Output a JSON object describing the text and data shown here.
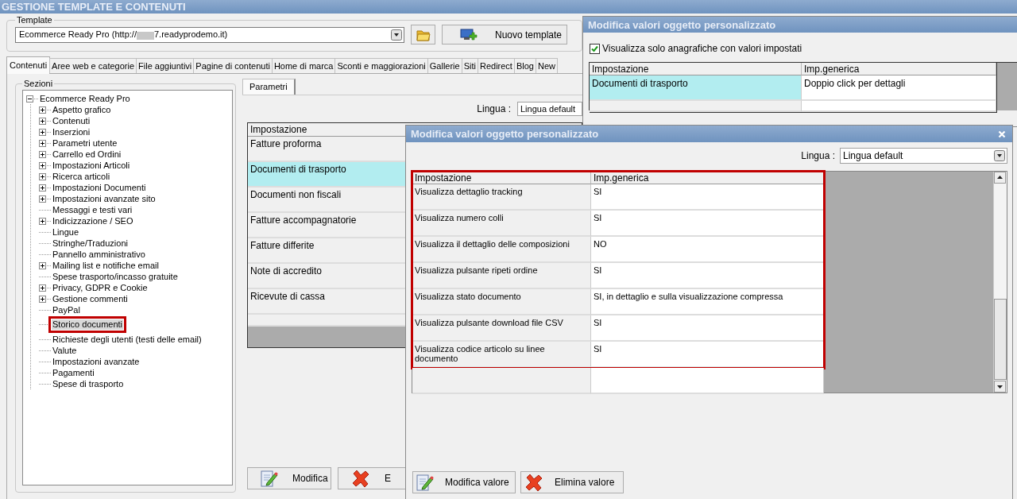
{
  "window": {
    "title": "GESTIONE TEMPLATE E CONTENUTI"
  },
  "template": {
    "label": "Template",
    "value_prefix": "Ecommerce Ready Pro (http://",
    "redacted": true,
    "value_suffix": "7.readyprodemo.it)",
    "new_button": "Nuovo template"
  },
  "tabs": [
    {
      "label": "Contenuti",
      "selected": true
    },
    {
      "label": "Aree web e categorie",
      "selected": false
    },
    {
      "label": "File aggiuntivi",
      "selected": false
    },
    {
      "label": "Pagine di contenuti",
      "selected": false
    },
    {
      "label": "Home di marca",
      "selected": false
    },
    {
      "label": "Sconti e maggiorazioni",
      "selected": false
    },
    {
      "label": "Gallerie",
      "selected": false
    },
    {
      "label": "Siti",
      "selected": false
    },
    {
      "label": "Redirect",
      "selected": false
    },
    {
      "label": "Blog",
      "selected": false
    },
    {
      "label": "New",
      "selected": false
    }
  ],
  "sections": {
    "title": "Sezioni",
    "tree": [
      {
        "label": "Ecommerce Ready Pro",
        "expanded": true,
        "children": [
          {
            "label": "Aspetto grafico",
            "expandable": true,
            "selected": false,
            "highlighted": false
          },
          {
            "label": "Contenuti",
            "expandable": true,
            "selected": false,
            "highlighted": false
          },
          {
            "label": "Inserzioni",
            "expandable": true,
            "selected": false,
            "highlighted": false
          },
          {
            "label": "Parametri utente",
            "expandable": true,
            "selected": false,
            "highlighted": false
          },
          {
            "label": "Carrello ed Ordini",
            "expandable": true,
            "selected": false,
            "highlighted": false
          },
          {
            "label": "Impostazioni Articoli",
            "expandable": true,
            "selected": false,
            "highlighted": false
          },
          {
            "label": "Ricerca articoli",
            "expandable": true,
            "selected": false,
            "highlighted": false
          },
          {
            "label": "Impostazioni Documenti",
            "expandable": true,
            "selected": false,
            "highlighted": false
          },
          {
            "label": "Impostazioni avanzate sito",
            "expandable": true,
            "selected": false,
            "highlighted": false
          },
          {
            "label": "Messaggi e testi vari",
            "expandable": false,
            "selected": false,
            "highlighted": false
          },
          {
            "label": "Indicizzazione / SEO",
            "expandable": true,
            "selected": false,
            "highlighted": false
          },
          {
            "label": "Lingue",
            "expandable": false,
            "selected": false,
            "highlighted": false
          },
          {
            "label": "Stringhe/Traduzioni",
            "expandable": false,
            "selected": false,
            "highlighted": false
          },
          {
            "label": "Pannello amministrativo",
            "expandable": false,
            "selected": false,
            "highlighted": false
          },
          {
            "label": "Mailing list e notifiche email",
            "expandable": true,
            "selected": false,
            "highlighted": false
          },
          {
            "label": "Spese trasporto/incasso gratuite",
            "expandable": false,
            "selected": false,
            "highlighted": false
          },
          {
            "label": "Privacy, GDPR e Cookie",
            "expandable": true,
            "selected": false,
            "highlighted": false
          },
          {
            "label": "Gestione commenti",
            "expandable": true,
            "selected": false,
            "highlighted": false
          },
          {
            "label": "PayPal",
            "expandable": false,
            "selected": false,
            "highlighted": false
          },
          {
            "label": "Storico documenti",
            "expandable": false,
            "selected": true,
            "highlighted": true
          },
          {
            "label": "Richieste degli utenti (testi delle email)",
            "expandable": false,
            "selected": false,
            "highlighted": false
          },
          {
            "label": "Valute",
            "expandable": false,
            "selected": false,
            "highlighted": false
          },
          {
            "label": "Impostazioni avanzate",
            "expandable": false,
            "selected": false,
            "highlighted": false
          },
          {
            "label": "Pagamenti",
            "expandable": false,
            "selected": false,
            "highlighted": false
          },
          {
            "label": "Spese di trasporto",
            "expandable": false,
            "selected": false,
            "highlighted": false
          }
        ]
      }
    ]
  },
  "params": {
    "tabs": [
      {
        "label": "Parametri",
        "selected": true
      }
    ],
    "language_label": "Lingua :",
    "language_value": "Lingua default",
    "columns": [
      "Impostazione"
    ],
    "rows": [
      {
        "label": "Fatture proforma",
        "selected": false
      },
      {
        "label": "Documenti di trasporto",
        "selected": true
      },
      {
        "label": "Documenti non fiscali",
        "selected": false
      },
      {
        "label": "Fatture accompagnatorie",
        "selected": false
      },
      {
        "label": "Fatture differite",
        "selected": false
      },
      {
        "label": "Note di accredito",
        "selected": false
      },
      {
        "label": "Ricevute di cassa",
        "selected": false
      }
    ],
    "buttons": [
      {
        "kind": "edit",
        "label": "Modifica"
      },
      {
        "kind": "delete",
        "label": "E"
      }
    ]
  },
  "dialog_back": {
    "title": "Modifica valori oggetto personalizzato",
    "checkbox": {
      "label": "Visualizza solo anagrafiche con valori impostati",
      "checked": true
    },
    "columns": [
      "Impostazione",
      "Imp.generica"
    ],
    "rows": [
      {
        "cells": [
          "Documenti di trasporto",
          "Doppio click per dettagli"
        ],
        "selected": true
      }
    ]
  },
  "dialog_front": {
    "title": "Modifica valori oggetto personalizzato",
    "language_label": "Lingua :",
    "language_value": "Lingua default",
    "highlighted": true,
    "columns": [
      "Impostazione",
      "Imp.generica"
    ],
    "rows": [
      {
        "cells": [
          "Visualizza dettaglio tracking",
          "SI"
        ]
      },
      {
        "cells": [
          "Visualizza numero colli",
          "SI"
        ]
      },
      {
        "cells": [
          "Visualizza il dettaglio delle composizioni",
          "NO"
        ]
      },
      {
        "cells": [
          "Visualizza pulsante ripeti ordine",
          "SI"
        ]
      },
      {
        "cells": [
          "Visualizza stato documento",
          "SI, in dettaglio e sulla visualizzazione compressa"
        ]
      },
      {
        "cells": [
          "Visualizza pulsante download file CSV",
          "SI"
        ]
      },
      {
        "cells": [
          "Visualizza codice articolo su linee documento",
          "SI"
        ]
      }
    ],
    "buttons": [
      {
        "kind": "edit",
        "label": "Modifica valore"
      },
      {
        "kind": "delete",
        "label": "Elimina valore"
      }
    ]
  }
}
